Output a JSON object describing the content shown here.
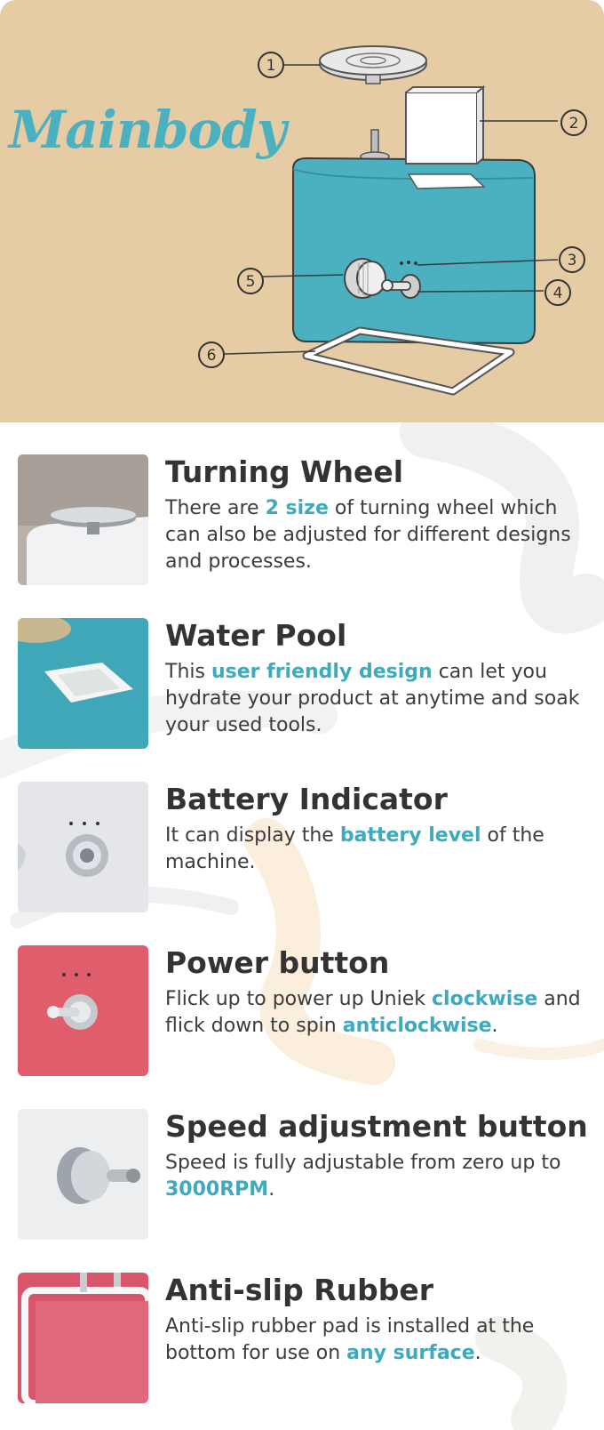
{
  "hero": {
    "title": "Mainbody",
    "callouts": [
      "1",
      "2",
      "3",
      "4",
      "5",
      "6"
    ]
  },
  "colors": {
    "hero_bg": "#e6cca4",
    "accent": "#3fa9bd",
    "machine_body": "#4bb1c0",
    "text": "#333333"
  },
  "features": [
    {
      "title": "Turning Wheel",
      "image_icon": "turning-wheel-photo",
      "desc": [
        {
          "t": "There are "
        },
        {
          "t": "2 size",
          "hl": true
        },
        {
          "t": " of turning wheel which can also be adjusted for different designs and processes."
        }
      ]
    },
    {
      "title": "Water Pool",
      "image_icon": "water-pool-photo",
      "desc": [
        {
          "t": "This "
        },
        {
          "t": "user friendly design",
          "hl": true
        },
        {
          "t": " can let you hydrate your product at anytime and soak your used tools."
        }
      ]
    },
    {
      "title": "Battery Indicator",
      "image_icon": "battery-indicator-photo",
      "desc": [
        {
          "t": "It can display the "
        },
        {
          "t": "battery level",
          "hl": true
        },
        {
          "t": " of the machine."
        }
      ]
    },
    {
      "title": "Power button",
      "image_icon": "power-button-photo",
      "desc": [
        {
          "t": "Flick up to power up Uniek "
        },
        {
          "t": "clockwise",
          "hl": true
        },
        {
          "t": " and flick down to spin "
        },
        {
          "t": "anticlockwise",
          "hl": true
        },
        {
          "t": "."
        }
      ]
    },
    {
      "title": "Speed adjustment button",
      "image_icon": "speed-knob-photo",
      "desc": [
        {
          "t": "Speed is fully adjustable from zero up to "
        },
        {
          "t": "3000RPM",
          "hl": true
        },
        {
          "t": "."
        }
      ]
    },
    {
      "title": "Anti-slip Rubber",
      "image_icon": "anti-slip-rubber-photo",
      "desc": [
        {
          "t": "Anti-slip rubber pad is installed at the bottom for use on "
        },
        {
          "t": "any surface",
          "hl": true
        },
        {
          "t": "."
        }
      ]
    }
  ]
}
